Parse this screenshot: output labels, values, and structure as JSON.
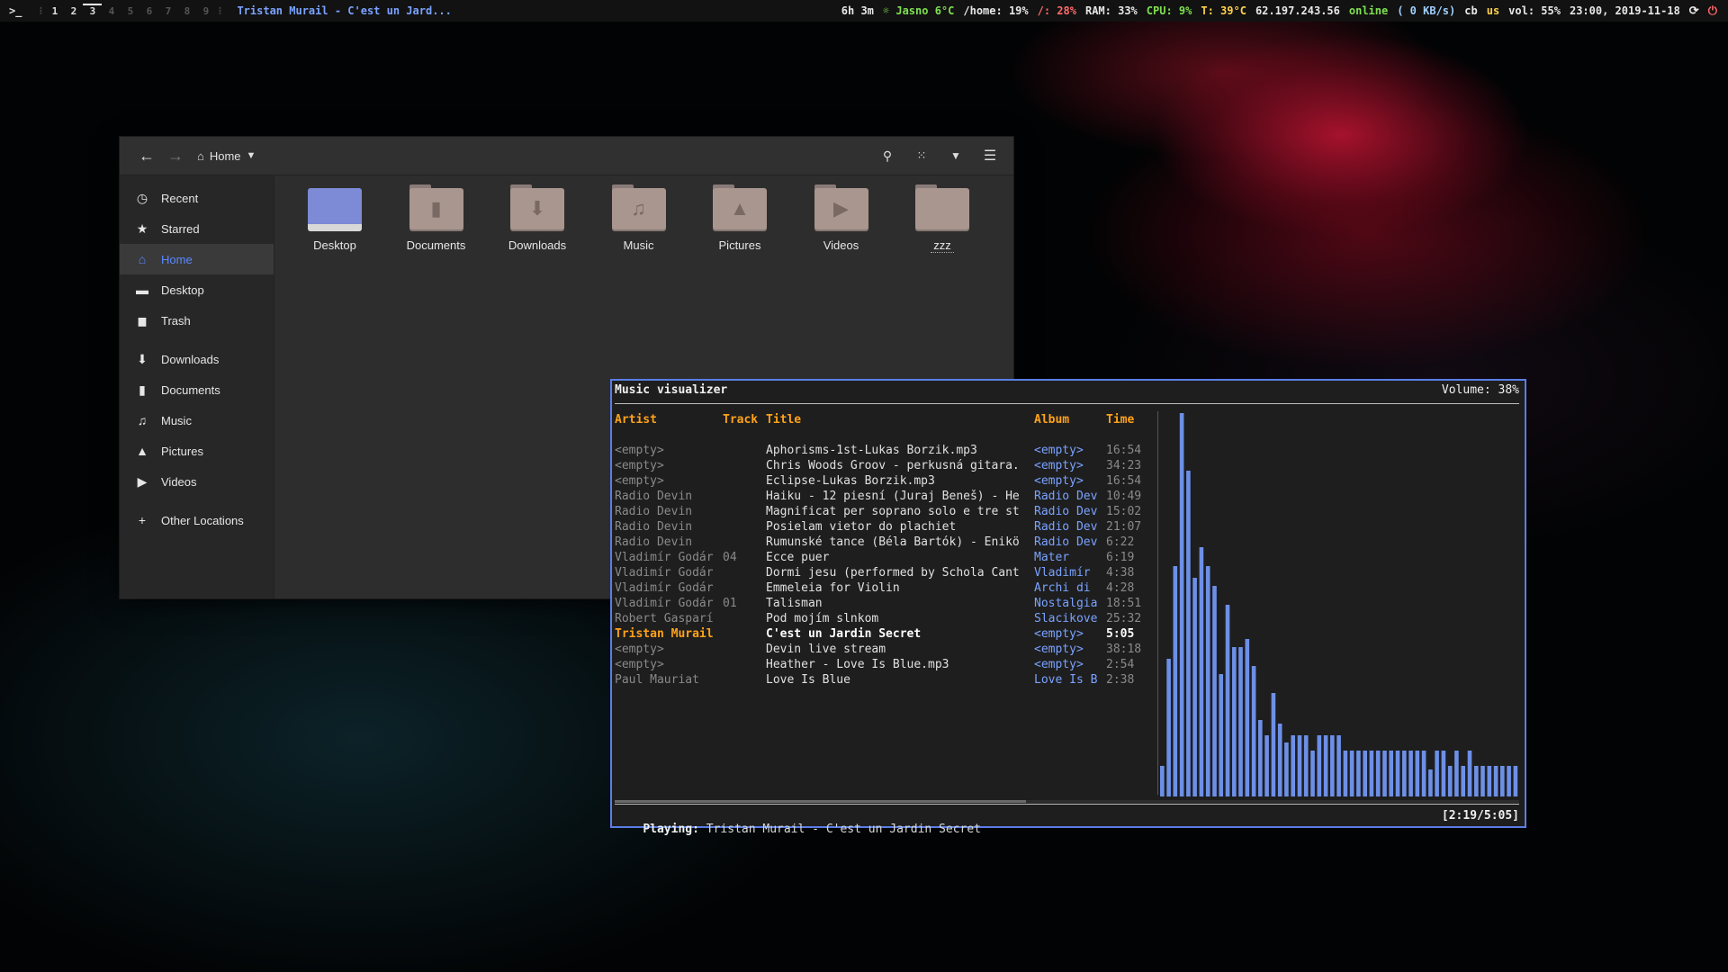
{
  "topbar": {
    "terminal_glyph": ">_",
    "workspaces": [
      "1",
      "2",
      "3",
      "4",
      "5",
      "6",
      "7",
      "8",
      "9"
    ],
    "active_workspace": "3",
    "used_workspaces": [
      "1",
      "2",
      "3"
    ],
    "window_title": "Tristan Murail - C'est un Jard...",
    "status": {
      "uptime": "6h 3m",
      "weather": "Jasno 6°C",
      "home_disk": "/home: 19%",
      "root_disk": "/: 28%",
      "ram": "RAM: 33%",
      "cpu_label": "CPU:",
      "cpu": "9%",
      "temp": "T: 39°C",
      "ip": "62.197.243.56",
      "net_state": "online",
      "net_speed": "(  0 KB/s)",
      "clipboard": "cb",
      "layout": "us",
      "volume": "vol: 55%",
      "datetime": "23:00, 2019-11-18",
      "refresh_icon": "refresh-icon",
      "power_icon": "power-icon"
    },
    "colors": {
      "title": "#7aa2ff",
      "green": "#7fe050",
      "red": "#ff6a6a",
      "yellow": "#ffd24a"
    }
  },
  "file_manager": {
    "location": "Home",
    "sidebar": [
      {
        "label": "Recent",
        "icon": "clock-icon"
      },
      {
        "label": "Starred",
        "icon": "star-icon"
      },
      {
        "label": "Home",
        "icon": "home-icon",
        "selected": true
      },
      {
        "label": "Desktop",
        "icon": "desktop-icon"
      },
      {
        "label": "Trash",
        "icon": "trash-icon"
      },
      {
        "label": "Downloads",
        "icon": "download-icon"
      },
      {
        "label": "Documents",
        "icon": "document-icon"
      },
      {
        "label": "Music",
        "icon": "music-icon"
      },
      {
        "label": "Pictures",
        "icon": "picture-icon"
      },
      {
        "label": "Videos",
        "icon": "video-icon"
      },
      {
        "label": "Other Locations",
        "icon": "plus-icon"
      }
    ],
    "folders": [
      "Desktop",
      "Documents",
      "Downloads",
      "Music",
      "Pictures",
      "Videos",
      "zzz"
    ],
    "accent": "#5a88ff"
  },
  "music": {
    "title": "Music visualizer",
    "volume": "Volume: 38%",
    "columns": {
      "artist": "Artist",
      "track": "Track",
      "title": "Title",
      "album": "Album",
      "time": "Time"
    },
    "rows": [
      {
        "artist": "<empty>",
        "track": "",
        "title": "Aphorisms-1st-Lukas Borzik.mp3",
        "album": "<empty>",
        "time": "16:54"
      },
      {
        "artist": "<empty>",
        "track": "",
        "title": "Chris Woods Groov - perkusná gitara.",
        "album": "<empty>",
        "time": "34:23"
      },
      {
        "artist": "<empty>",
        "track": "",
        "title": "Eclipse-Lukas Borzik.mp3",
        "album": "<empty>",
        "time": "16:54"
      },
      {
        "artist": "Radio Devin",
        "track": "",
        "title": "Haiku - 12 piesní (Juraj Beneš) - He",
        "album": "Radio Dev",
        "time": "10:49"
      },
      {
        "artist": "Radio Devin",
        "track": "",
        "title": "Magnificat per soprano solo e tre st",
        "album": "Radio Dev",
        "time": "15:02"
      },
      {
        "artist": "Radio Devin",
        "track": "",
        "title": "Posielam vietor do plachiet",
        "album": "Radio Dev",
        "time": "21:07"
      },
      {
        "artist": "Radio Devin",
        "track": "",
        "title": "Rumunské tance (Béla Bartók) - Enikö",
        "album": "Radio Dev",
        "time": "6:22"
      },
      {
        "artist": "Vladimír Godár",
        "track": "04",
        "title": "Ecce puer",
        "album": "Mater",
        "time": "6:19"
      },
      {
        "artist": "Vladimír Godár",
        "track": "",
        "title": "Dormi jesu (performed by Schola Cant",
        "album": "Vladimír",
        "time": "4:38"
      },
      {
        "artist": "Vladimír Godár",
        "track": "",
        "title": "Emmeleia for Violin",
        "album": "Archi di",
        "time": "4:28"
      },
      {
        "artist": "Vladimír Godár",
        "track": "01",
        "title": "Talisman",
        "album": "Nostalgia",
        "time": "18:51"
      },
      {
        "artist": "Robert Gasparí",
        "track": "",
        "title": "Pod mojím slnkom",
        "album": "Slacikove",
        "time": "25:32"
      },
      {
        "artist": "Tristan Murail",
        "track": "",
        "title": "C'est un Jardin Secret",
        "album": "<empty>",
        "time": "5:05",
        "current": true
      },
      {
        "artist": "<empty>",
        "track": "",
        "title": "Devin live stream",
        "album": "<empty>",
        "time": "38:18"
      },
      {
        "artist": "<empty>",
        "track": "",
        "title": "Heather - Love Is Blue.mp3",
        "album": "<empty>",
        "time": "2:54"
      },
      {
        "artist": "Paul Mauriat",
        "track": "",
        "title": "Love Is Blue",
        "album": "Love Is B",
        "time": "2:38"
      }
    ],
    "playing_label": "Playing:",
    "playing_text": "Tristan Murail - C'est un Jardin Secret",
    "progress": "[2:19/5:05]",
    "progress_fraction": 0.456,
    "visualizer_levels": [
      0.08,
      0.36,
      0.6,
      1.0,
      0.85,
      0.57,
      0.65,
      0.6,
      0.55,
      0.32,
      0.5,
      0.39,
      0.39,
      0.41,
      0.34,
      0.2,
      0.16,
      0.27,
      0.19,
      0.14,
      0.16,
      0.16,
      0.16,
      0.12,
      0.16,
      0.16,
      0.16,
      0.16,
      0.12,
      0.12,
      0.12,
      0.12,
      0.12,
      0.12,
      0.12,
      0.12,
      0.12,
      0.12,
      0.12,
      0.12,
      0.12,
      0.07,
      0.12,
      0.12,
      0.08,
      0.12,
      0.08,
      0.12,
      0.08,
      0.08,
      0.08,
      0.08,
      0.08,
      0.08,
      0.08
    ],
    "visualizer_color": "#6d8fe6",
    "border_color": "#5a7ee8"
  }
}
